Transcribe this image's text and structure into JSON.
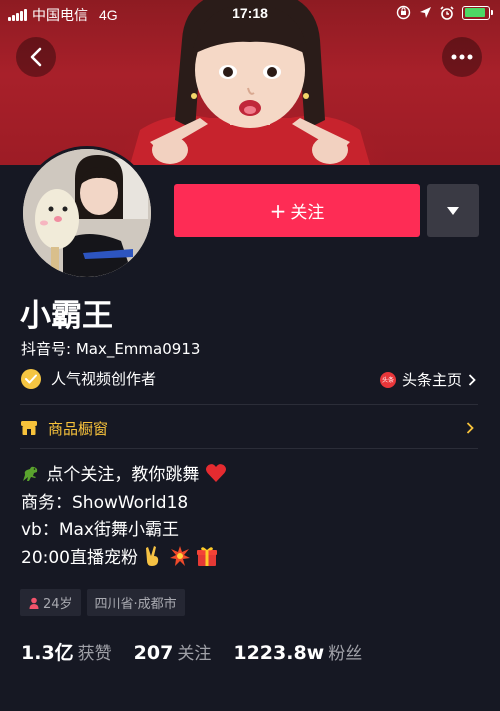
{
  "status_bar": {
    "carrier": "中国电信",
    "network": "4G",
    "time": "17:18"
  },
  "header": {
    "back_icon": "chevron-left-icon",
    "more_icon": "ellipsis-icon"
  },
  "profile": {
    "follow_label": "关注",
    "name": "小霸王",
    "douyin_id": "抖音号: Max_Emma0913",
    "creator_badge": "人气视频创作者",
    "toutiao_link": "头条主页",
    "toutiao_logo_text": "头条"
  },
  "shop": {
    "label": "商品橱窗"
  },
  "bio": {
    "lines": [
      "点个关注，教你跳舞",
      "商务：ShowWorld18",
      "vb：Max街舞小霸王",
      "20:00直播宠粉"
    ]
  },
  "tags": {
    "age": "24岁",
    "location": "四川省·成都市"
  },
  "stats": [
    {
      "value": "1.3亿",
      "label": "获赞"
    },
    {
      "value": "207",
      "label": "关注"
    },
    {
      "value": "1223.8w",
      "label": "粉丝"
    }
  ],
  "colors": {
    "background": "#161823",
    "follow_button": "#fe2c55",
    "shop_accent": "#f7c23b",
    "cover": "#a8202a"
  }
}
